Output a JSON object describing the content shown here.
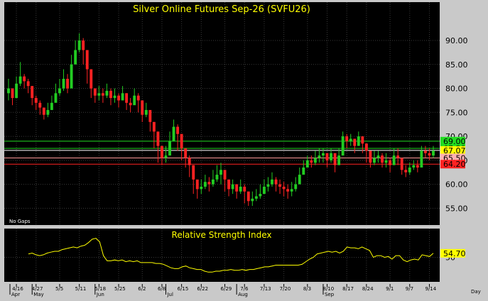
{
  "colors": {
    "background": "#000000",
    "frame": "#c9c9c9",
    "grid": "#3a3a3a",
    "up_candle": "#22cc22",
    "down_candle": "#ff2222",
    "title_text": "#ffff00",
    "axis_text": "#000000",
    "rsi_line": "#ffff00",
    "h_line_green": "#22dd22",
    "h_line_pink": "#ff9a9a",
    "h_line_red": "#ff2222",
    "h_line_white": "#ffffff"
  },
  "chart_data": [
    {
      "type": "candlestick",
      "title": "Silver Online Futures Sep-26 (SVFU26)",
      "annotation": "No Gaps",
      "ylim": [
        51.5,
        98
      ],
      "y_ticks": [
        "55.00",
        "60.00",
        "65.00",
        "70.00",
        "75.00",
        "80.00",
        "85.00",
        "90.00"
      ],
      "x_tick_labels": [
        "4/16",
        "4/27",
        "5/5",
        "5/11",
        "5/18",
        "5/25",
        "6/2",
        "6/8",
        "6/15",
        "6/22",
        "6/29",
        "7/6",
        "7/13",
        "7/20",
        "8/3",
        "8/10",
        "8/17",
        "8/24",
        "9/1",
        "9/7",
        "9/14"
      ],
      "month_labels": [
        "Apr",
        "May",
        "Jun",
        "Jul",
        "Aug",
        "Sep"
      ],
      "horizontal_levels": [
        {
          "value": 69.0,
          "label": "69.00",
          "color": "#22dd22",
          "label_bg": "#22dd22",
          "label_fg": "#000000"
        },
        {
          "value": 67.5,
          "label": "67.50",
          "color": "#22dd22",
          "label_bg": "#22dd22",
          "label_fg": "#000000"
        },
        {
          "value": 67.07,
          "label": "67.07",
          "color": "#ffffff",
          "label_bg": "#ffff00",
          "label_fg": "#000000"
        },
        {
          "value": 65.5,
          "label": "65.50",
          "color": "#ff9a9a",
          "label_bg": "#ffb0b0",
          "label_fg": "#000000"
        },
        {
          "value": 64.2,
          "label": "64.20",
          "color": "#ff2222",
          "label_bg": "#ff2222",
          "label_fg": "#000000"
        }
      ],
      "last_close": 67.07,
      "closes_approx": [
        80.0,
        78.0,
        81.0,
        82.5,
        81.5,
        80.5,
        78.0,
        77.0,
        76.0,
        74.5,
        75.5,
        77.0,
        79.0,
        80.0,
        82.0,
        80.0,
        85.0,
        88.0,
        90.0,
        88.0,
        84.0,
        80.0,
        78.5,
        79.0,
        78.5,
        79.5,
        78.0,
        78.5,
        77.5,
        79.0,
        77.0,
        76.5,
        78.5,
        77.5,
        74.5,
        75.5,
        73.0,
        71.0,
        68.0,
        65.5,
        66.0,
        69.0,
        72.0,
        70.5,
        67.5,
        65.5,
        64.0,
        61.0,
        59.0,
        59.5,
        60.5,
        60.0,
        61.0,
        62.0,
        63.0,
        61.0,
        59.0,
        60.0,
        58.5,
        59.5,
        58.5,
        56.5,
        57.0,
        57.5,
        58.0,
        59.5,
        60.0,
        61.0,
        60.0,
        59.5,
        59.0,
        58.5,
        59.0,
        60.0,
        62.0,
        63.5,
        65.0,
        64.5,
        65.5,
        66.0,
        66.5,
        65.0,
        66.5,
        64.0,
        66.0,
        70.0,
        69.0,
        69.5,
        68.0,
        70.0,
        68.5,
        67.0,
        64.5,
        65.5,
        66.0,
        64.5,
        65.0,
        64.0,
        66.0,
        65.5,
        63.0,
        62.5,
        63.5,
        64.0,
        63.5,
        67.0,
        66.5,
        66.0,
        67.0
      ],
      "highs_approx": [
        82.0,
        80.0,
        82.5,
        85.5,
        83.0,
        82.0,
        80.5,
        78.5,
        77.5,
        76.0,
        77.0,
        78.5,
        81.0,
        82.0,
        84.0,
        83.0,
        87.0,
        90.0,
        91.5,
        90.5,
        86.0,
        82.0,
        80.0,
        80.5,
        80.0,
        81.0,
        80.0,
        80.0,
        79.0,
        80.5,
        79.0,
        78.0,
        80.0,
        79.0,
        76.5,
        77.0,
        75.0,
        73.0,
        70.0,
        67.5,
        68.0,
        71.0,
        73.5,
        72.5,
        69.0,
        67.0,
        66.0,
        63.0,
        60.5,
        61.0,
        62.0,
        61.5,
        63.0,
        64.0,
        64.5,
        62.5,
        60.5,
        61.0,
        60.0,
        61.0,
        60.0,
        58.0,
        58.5,
        59.0,
        60.0,
        61.0,
        61.5,
        62.5,
        61.5,
        61.0,
        60.5,
        60.0,
        60.5,
        61.5,
        63.5,
        65.0,
        66.0,
        66.0,
        67.0,
        67.5,
        67.5,
        66.5,
        67.5,
        65.5,
        67.5,
        71.0,
        70.5,
        70.5,
        69.5,
        71.0,
        70.0,
        68.5,
        66.5,
        67.0,
        67.0,
        66.5,
        66.5,
        65.5,
        67.5,
        67.5,
        65.0,
        64.0,
        64.5,
        65.0,
        65.0,
        68.0,
        68.0,
        67.5,
        68.0
      ],
      "lows_approx": [
        77.5,
        76.5,
        78.5,
        80.5,
        80.0,
        79.0,
        76.5,
        75.5,
        74.5,
        73.5,
        74.0,
        75.5,
        77.5,
        78.5,
        79.5,
        79.0,
        81.0,
        86.0,
        87.5,
        85.0,
        81.0,
        78.0,
        77.0,
        77.5,
        77.0,
        78.0,
        76.5,
        77.0,
        76.0,
        77.5,
        75.5,
        75.0,
        77.0,
        75.0,
        73.0,
        74.0,
        71.0,
        67.5,
        64.5,
        64.0,
        64.5,
        67.0,
        70.0,
        67.0,
        65.0,
        63.5,
        61.5,
        58.0,
        57.0,
        58.0,
        59.0,
        58.5,
        59.5,
        60.5,
        60.0,
        58.5,
        57.5,
        58.0,
        57.0,
        58.0,
        56.0,
        55.5,
        55.5,
        56.5,
        57.0,
        58.0,
        58.5,
        59.5,
        58.5,
        58.0,
        57.5,
        57.0,
        57.5,
        58.5,
        60.5,
        62.0,
        63.5,
        63.5,
        64.0,
        64.5,
        64.5,
        63.5,
        64.5,
        62.5,
        64.0,
        68.0,
        67.5,
        68.0,
        66.5,
        68.0,
        66.5,
        64.5,
        63.5,
        64.0,
        64.5,
        63.5,
        63.5,
        62.5,
        64.0,
        64.0,
        62.0,
        61.5,
        62.0,
        63.0,
        62.5,
        65.0,
        65.5,
        65.0,
        65.5
      ]
    },
    {
      "type": "line",
      "title": "Relative Strength Index",
      "ylim": [
        0,
        100
      ],
      "y_ticks": [
        "50"
      ],
      "last_value_label": "54.70",
      "values_approx": [
        54,
        55,
        53,
        52,
        53,
        55,
        56,
        57,
        57,
        59,
        60,
        61,
        62,
        61,
        63,
        64,
        67,
        71,
        72,
        68,
        52,
        46,
        46,
        47,
        46,
        47,
        45,
        46,
        45,
        46,
        44,
        44,
        44,
        44,
        43,
        43,
        42,
        40,
        38,
        37,
        37,
        39,
        40,
        38,
        37,
        36,
        36,
        34,
        33,
        33,
        34,
        34,
        35,
        35,
        36,
        35,
        35,
        36,
        35,
        36,
        36,
        37,
        38,
        39,
        39,
        40,
        41,
        41,
        41,
        41,
        41,
        41,
        41,
        42,
        45,
        48,
        50,
        54,
        55,
        56,
        57,
        56,
        57,
        55,
        57,
        62,
        61,
        61,
        60,
        62,
        60,
        58,
        50,
        52,
        52,
        50,
        51,
        48,
        52,
        52,
        47,
        45,
        47,
        48,
        47,
        53,
        52,
        51,
        54.7
      ]
    }
  ]
}
